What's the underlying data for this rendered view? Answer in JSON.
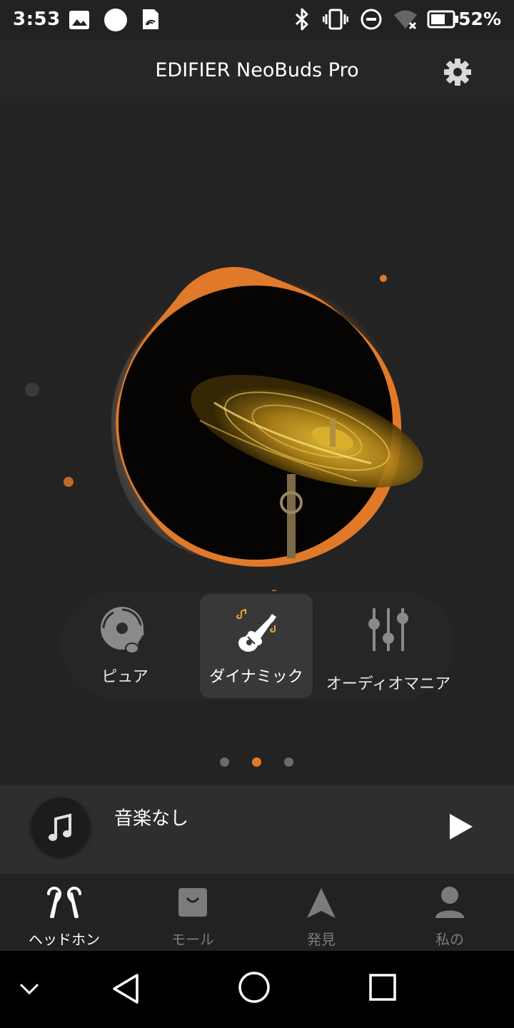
{
  "status_bar": {
    "time": "3:53",
    "battery_percent": "52%",
    "icons": [
      "image-icon",
      "circle-notification-icon",
      "sim-card-icon",
      "bluetooth-icon",
      "vibrate-icon",
      "do-not-disturb-icon",
      "wifi-off-icon",
      "battery-icon"
    ]
  },
  "header": {
    "title": "EDIFIER NeoBuds Pro",
    "settings_icon": "gear-icon"
  },
  "hero": {
    "accent_color": "#e07a2a",
    "image": "cymbal-image"
  },
  "modes": [
    {
      "label": "ピュア",
      "icon": "vinyl-note-icon",
      "active": false
    },
    {
      "label": "ダイナミック",
      "icon": "guitar-icon",
      "active": true
    },
    {
      "label": "オーディオマニア",
      "icon": "equalizer-icon",
      "active": false
    }
  ],
  "pager": {
    "count": 3,
    "active_index": 1
  },
  "player": {
    "track_title": "音楽なし",
    "icons": [
      "music-note-icon",
      "play-icon"
    ]
  },
  "bottom_nav": [
    {
      "label": "ヘッドホン",
      "icon": "earbuds-icon",
      "active": true
    },
    {
      "label": "モール",
      "icon": "shopping-bag-icon",
      "active": false
    },
    {
      "label": "発見",
      "icon": "discover-arrow-icon",
      "active": false
    },
    {
      "label": "私の",
      "icon": "person-icon",
      "active": false
    }
  ],
  "system_nav": [
    "chevron-down-icon",
    "back-icon",
    "home-icon",
    "recents-icon"
  ]
}
